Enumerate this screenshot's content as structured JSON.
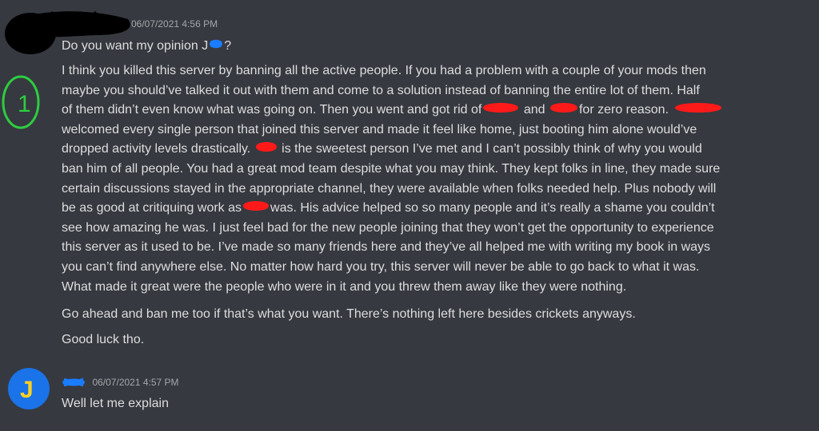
{
  "colors": {
    "background": "#36393f",
    "text": "#dcddde",
    "timestamp": "#a3a6aa",
    "redaction_red": "#ff1a1a",
    "redaction_blue": "#1a7cff",
    "redaction_black": "#000000",
    "annotation_green": "#2ecc40",
    "avatar_j_bg": "#1a73e8",
    "avatar_j_letter": "#ffd21f"
  },
  "messages": [
    {
      "timestamp": "06/07/2021 4:56 PM",
      "line1": {
        "text": "Do you want my opinion J",
        "suffix": "?"
      },
      "annotation_digit": "1",
      "para_lines": [
        {
          "text": "I think you killed this server by banning all the active people. If you had a problem with a couple of your mods then"
        },
        {
          "text": "maybe you should’ve talked it out with them and come to a solution instead of banning the entire lot of them. Half"
        },
        {
          "a": "of them didn’t even know what was going on. Then you went and got rid of",
          "b": " and ",
          "c": "for zero reason."
        },
        {
          "text": "welcomed every single person that joined this server and made it feel like home, just booting him alone would’ve"
        },
        {
          "a": "dropped activity levels drastically. ",
          "b": " is the sweetest person I’ve met and I can’t possibly think of why you would"
        },
        {
          "text": "ban him of all people. You had a great mod team despite what you may think. They kept folks in line, they made sure"
        },
        {
          "text": "certain discussions stayed in the appropriate channel, they were available when folks needed help. Plus nobody will"
        },
        {
          "a": "be as good at critiquing work as",
          "b": "was. His advice helped so so many people and it’s really a shame you couldn’t"
        },
        {
          "text": "see how amazing he was. I just feel bad for the new people joining that they won’t get the opportunity to experience"
        },
        {
          "text": "this server as it used to be. I’ve made so many friends here and they’ve all helped me with writing my book in ways"
        },
        {
          "text": "you can’t find anywhere else. No matter how hard you try, this server will never be able to go back to what it was."
        },
        {
          "text": "What made it great were the people who were in it and you threw them away like they were nothing."
        }
      ],
      "line_ban": "Go ahead and ban me too if that’s what you want. There’s nothing left here besides crickets anyways.",
      "line_luck": "Good luck tho."
    },
    {
      "avatar_letter": "J",
      "timestamp": "06/07/2021 4:57 PM",
      "text": "Well let me explain"
    }
  ]
}
